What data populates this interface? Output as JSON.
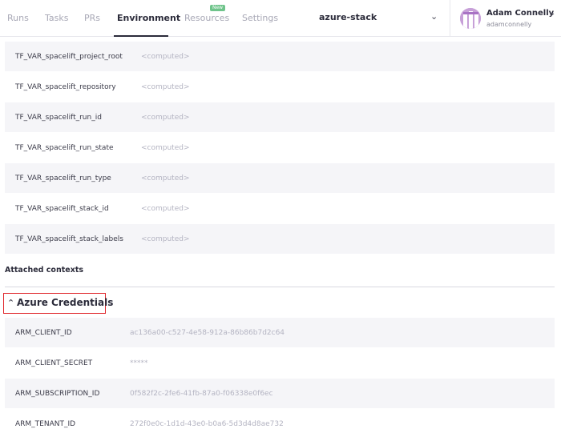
{
  "nav": {
    "tabs": [
      {
        "label": "Runs"
      },
      {
        "label": "Tasks"
      },
      {
        "label": "PRs"
      },
      {
        "label": "Environment"
      },
      {
        "label": "Resources"
      },
      {
        "label": "Settings"
      }
    ],
    "active_tab": "Environment",
    "new_badge": "New",
    "stack_name": "azure-stack"
  },
  "user": {
    "name": "Adam Connelly",
    "login": "adamconnelly"
  },
  "environment": {
    "rows": [
      {
        "key": "TF_VAR_spacelift_project_root",
        "value": "<computed>"
      },
      {
        "key": "TF_VAR_spacelift_repository",
        "value": "<computed>"
      },
      {
        "key": "TF_VAR_spacelift_run_id",
        "value": "<computed>"
      },
      {
        "key": "TF_VAR_spacelift_run_state",
        "value": "<computed>"
      },
      {
        "key": "TF_VAR_spacelift_run_type",
        "value": "<computed>"
      },
      {
        "key": "TF_VAR_spacelift_stack_id",
        "value": "<computed>"
      },
      {
        "key": "TF_VAR_spacelift_stack_labels",
        "value": "<computed>"
      }
    ]
  },
  "attached_contexts": {
    "title": "Attached contexts",
    "context": {
      "name": "Azure Credentials",
      "expanded": true,
      "rows": [
        {
          "key": "ARM_CLIENT_ID",
          "value": "ac136a00-c527-4e58-912a-86b86b7d2c64"
        },
        {
          "key": "ARM_CLIENT_SECRET",
          "value": "*****"
        },
        {
          "key": "ARM_SUBSCRIPTION_ID",
          "value": "0f582f2c-2fe6-41fb-87a0-f06338e0f6ec"
        },
        {
          "key": "ARM_TENANT_ID",
          "value": "272f0e0c-1d1d-43e0-b0a6-5d3d4d8ae732"
        }
      ]
    }
  },
  "colors": {
    "highlight_border": "#e0262b",
    "badge": "#6fc48b",
    "avatar": "#c7a0d8"
  }
}
